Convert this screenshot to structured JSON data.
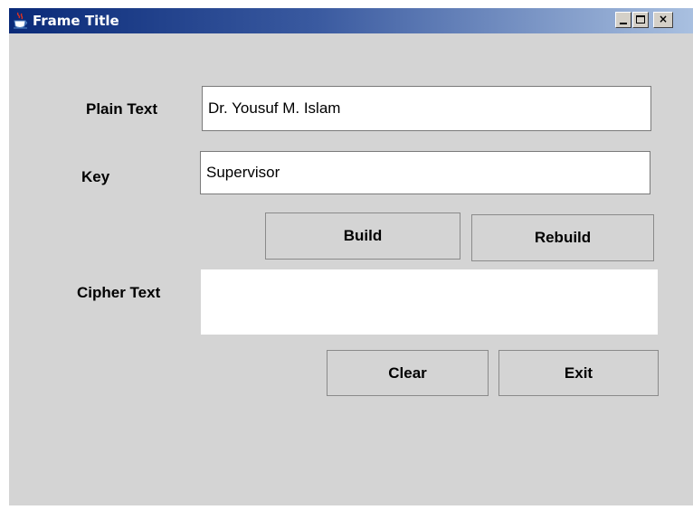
{
  "window": {
    "title": "Frame Title",
    "controls": {
      "minimize": "_",
      "maximize": "□",
      "close": "×"
    }
  },
  "form": {
    "plain_text_label": "Plain Text",
    "plain_text_value": "Dr. Yousuf M. Islam",
    "key_label": "Key",
    "key_value": "Supervisor",
    "cipher_text_label": "Cipher Text",
    "cipher_text_value": ""
  },
  "buttons": {
    "build": "Build",
    "rebuild": "Rebuild",
    "clear": "Clear",
    "exit": "Exit"
  },
  "colors": {
    "panel_background": "#d4d4d4",
    "titlebar_start": "#0a2a78",
    "titlebar_end": "#a9c0e0"
  },
  "icons": {
    "app_icon": "java-coffee-cup-icon"
  }
}
